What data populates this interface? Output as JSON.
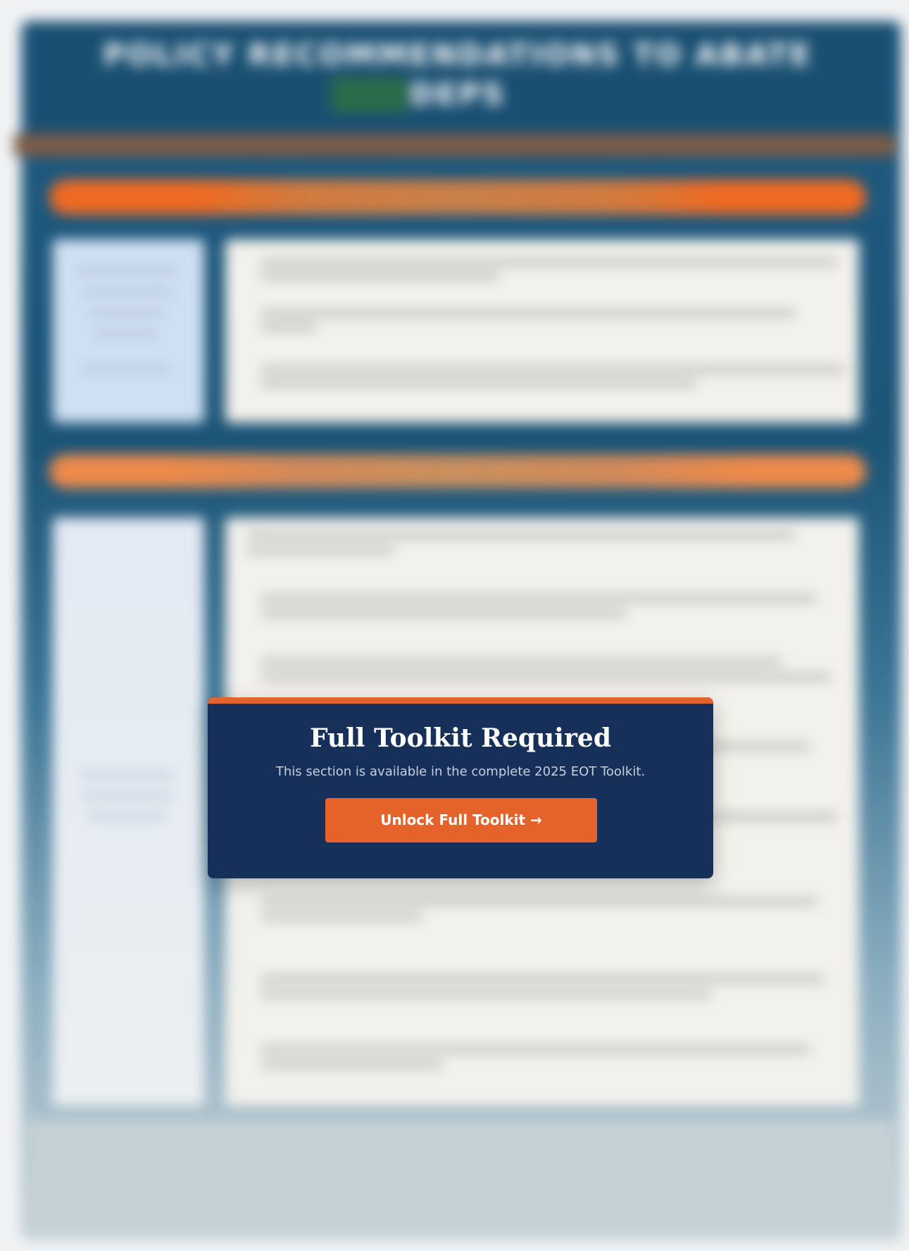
{
  "document": {
    "title": "POLICY RECOMMENDATIONS TO ABATE DEPS"
  },
  "modal": {
    "title": "Full Toolkit Required",
    "message": "This section is available in the complete 2025 EOT Toolkit.",
    "button_label": "Unlock Full Toolkit →"
  },
  "colors": {
    "modal_background": "#16305a",
    "accent": "#e6622b",
    "doc_header": "#1a4f72"
  }
}
